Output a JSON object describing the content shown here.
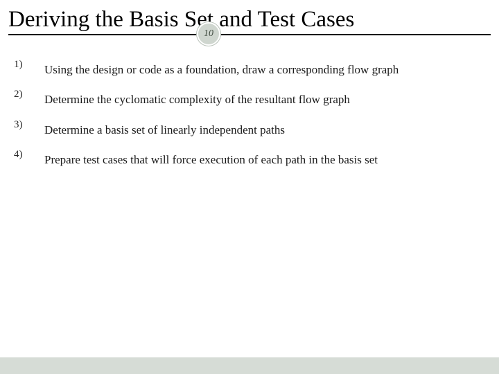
{
  "title": "Deriving the Basis Set and Test Cases",
  "badge": "10",
  "items": [
    {
      "num": "1)",
      "text": "Using the design or code as a foundation, draw a corresponding flow graph"
    },
    {
      "num": "2)",
      "text": "Determine the cyclomatic complexity of the resultant flow graph"
    },
    {
      "num": "3)",
      "text": "Determine a basis set of linearly independent paths"
    },
    {
      "num": "4)",
      "text": "Prepare test cases that will force execution of each path in the basis set"
    }
  ]
}
